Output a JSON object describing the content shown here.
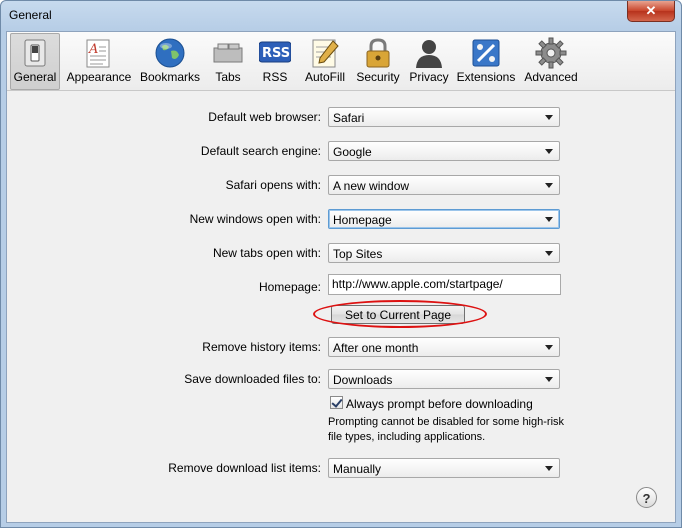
{
  "window": {
    "title": "General",
    "close_label": "✕"
  },
  "toolbar": {
    "items": [
      {
        "label": "General",
        "icon": "general-switch-icon",
        "selected": true
      },
      {
        "label": "Appearance",
        "icon": "appearance-icon"
      },
      {
        "label": "Bookmarks",
        "icon": "globe-icon"
      },
      {
        "label": "Tabs",
        "icon": "tabs-icon"
      },
      {
        "label": "RSS",
        "icon": "rss-icon",
        "badge": "RSS"
      },
      {
        "label": "AutoFill",
        "icon": "autofill-icon"
      },
      {
        "label": "Security",
        "icon": "lock-icon"
      },
      {
        "label": "Privacy",
        "icon": "privacy-person-icon"
      },
      {
        "label": "Extensions",
        "icon": "extensions-icon"
      },
      {
        "label": "Advanced",
        "icon": "gear-icon"
      }
    ]
  },
  "form": {
    "default_browser": {
      "label": "Default web browser:",
      "value": "Safari"
    },
    "search_engine": {
      "label": "Default search engine:",
      "value": "Google"
    },
    "opens_with": {
      "label": "Safari opens with:",
      "value": "A new window"
    },
    "new_windows": {
      "label": "New windows open with:",
      "value": "Homepage"
    },
    "new_tabs": {
      "label": "New tabs open with:",
      "value": "Top Sites"
    },
    "homepage": {
      "label": "Homepage:",
      "value": "http://www.apple.com/startpage/"
    },
    "set_current_label": "Set to Current Page",
    "history": {
      "label": "Remove history items:",
      "value": "After one month"
    },
    "downloads": {
      "label": "Save downloaded files to:",
      "value": "Downloads"
    },
    "prompt_checkbox": {
      "label": "Always prompt before downloading",
      "checked": true
    },
    "prompt_note": "Prompting cannot be disabled for some high-risk file types, including applications.",
    "download_list": {
      "label": "Remove download list items:",
      "value": "Manually"
    }
  },
  "help_label": "?",
  "colors": {
    "highlight_oval": "#dd1111",
    "titlebar": "#b6cde6"
  }
}
